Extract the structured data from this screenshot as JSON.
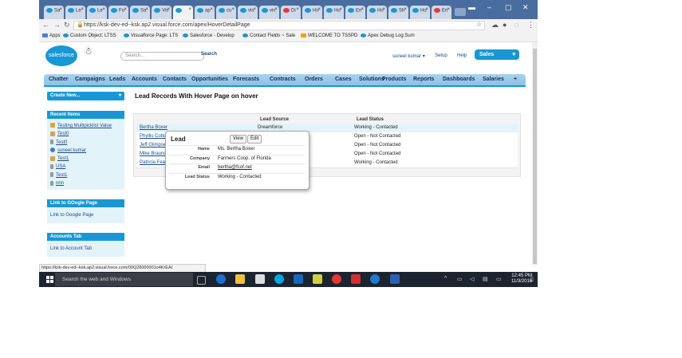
{
  "tabs": [
    {
      "label": "Sa",
      "fav": "sf"
    },
    {
      "label": "Le",
      "fav": "sf"
    },
    {
      "label": "Le",
      "fav": "sf"
    },
    {
      "label": "Fo",
      "fav": "sf"
    },
    {
      "label": "Sa",
      "fav": "sf"
    },
    {
      "label": "Vis",
      "fav": "sf"
    },
    {
      "label": "",
      "fav": "sf",
      "active": true
    },
    {
      "label": "ap",
      "fav": "sf"
    },
    {
      "label": "cu",
      "fav": "sf"
    },
    {
      "label": "vis",
      "fav": "sf"
    },
    {
      "label": "vis",
      "fav": "sf"
    },
    {
      "label": "Di",
      "fav": "g"
    },
    {
      "label": "Ho",
      "fav": "sf"
    },
    {
      "label": "Ho",
      "fav": "sf"
    },
    {
      "label": "En",
      "fav": "sf"
    },
    {
      "label": "Ho",
      "fav": "sf"
    },
    {
      "label": "Sh",
      "fav": "sf"
    },
    {
      "label": "Ho",
      "fav": "sf"
    },
    {
      "label": "En",
      "fav": "g"
    }
  ],
  "address": {
    "url": "https://ksk-dev-ed--ksk.ap2.visual.force.com/apex/HoverDetailPage"
  },
  "bookmarks": [
    {
      "label": "Apps",
      "icon": "apps-icon"
    },
    {
      "label": "Custom Object: LTSS",
      "icon": "salesforce-cloud-icon"
    },
    {
      "label": "Visualforce Page: LTS",
      "icon": "salesforce-cloud-icon"
    },
    {
      "label": "Salesforce - Develop",
      "icon": "salesforce-cloud-icon"
    },
    {
      "label": "Contact Fields ~ Sale",
      "icon": "page-icon"
    },
    {
      "label": "WELCOME TO TSSPD",
      "icon": "bookmark-icon"
    },
    {
      "label": "Apex Debug Log:Sum",
      "icon": "salesforce-cloud-icon"
    }
  ],
  "header": {
    "logo": "salesforce",
    "search_placeholder": "Search...",
    "search_button": "Search",
    "user": "suneel kumar",
    "setup": "Setup",
    "help": "Help",
    "app": "Sales"
  },
  "nav": [
    "Chatter",
    "Campaigns",
    "Leads",
    "Accounts",
    "Contacts",
    "Opportunities",
    "Forecasts",
    "Contracts",
    "Orders",
    "Cases",
    "Solutions",
    "Products",
    "Reports",
    "Dashboards",
    "Salaries",
    "+"
  ],
  "sidebar": {
    "create_new": "Create New...",
    "recent_title": "Recent Items",
    "recent": [
      {
        "label": "Testing Multipicklist Value",
        "icon": "custom"
      },
      {
        "label": "Test0",
        "icon": "custom"
      },
      {
        "label": "Test0",
        "icon": "doc"
      },
      {
        "label": "suneel kumar",
        "icon": "person"
      },
      {
        "label": "Test1",
        "icon": "custom"
      },
      {
        "label": "USA",
        "icon": "doc"
      },
      {
        "label": "Test1",
        "icon": "doc"
      },
      {
        "label": "nnn",
        "icon": "doc"
      }
    ],
    "google_title": "Link to GOogle Page",
    "google_link": "Link to Google Page",
    "accounts_title": "Accounts Tab",
    "accounts_link": "Link to Account Tab"
  },
  "main": {
    "title": "Lead Records With Hover Page on hover",
    "col_source": "Lead Source",
    "col_status": "Lead Status",
    "rows": [
      {
        "name": "Bertha Boxer",
        "source": "Dreamforce",
        "status": "Working - Contacted"
      },
      {
        "name": "Phyllis Cotton",
        "source": "",
        "status": "Open - Not Contacted"
      },
      {
        "name": "Jeff Glimpse",
        "source": "",
        "status": "Open - Not Contacted"
      },
      {
        "name": "Mike Braund",
        "source": "",
        "status": "Open - Not Contacted"
      },
      {
        "name": "Patricia Feager",
        "source": "",
        "status": "Working - Contacted"
      }
    ]
  },
  "hover": {
    "title": "Lead",
    "view": "View",
    "edit": "Edit",
    "fields": [
      {
        "label": "Name",
        "value": "Ms. Bertha Boxer"
      },
      {
        "label": "Company",
        "value": "Farmers Coop. of Florida"
      },
      {
        "label": "Email",
        "value": "bertha@fcof.net"
      },
      {
        "label": "Lead Status",
        "value": "Working - Contacted"
      }
    ]
  },
  "status_url": "https://ksk-dev-ed--ksk.ap2.visual.force.com/00Q28000001o4KrEAI",
  "taskbar": {
    "search": "Search the web and Windows",
    "time": "12:45 PM",
    "date": "11/3/2016"
  }
}
